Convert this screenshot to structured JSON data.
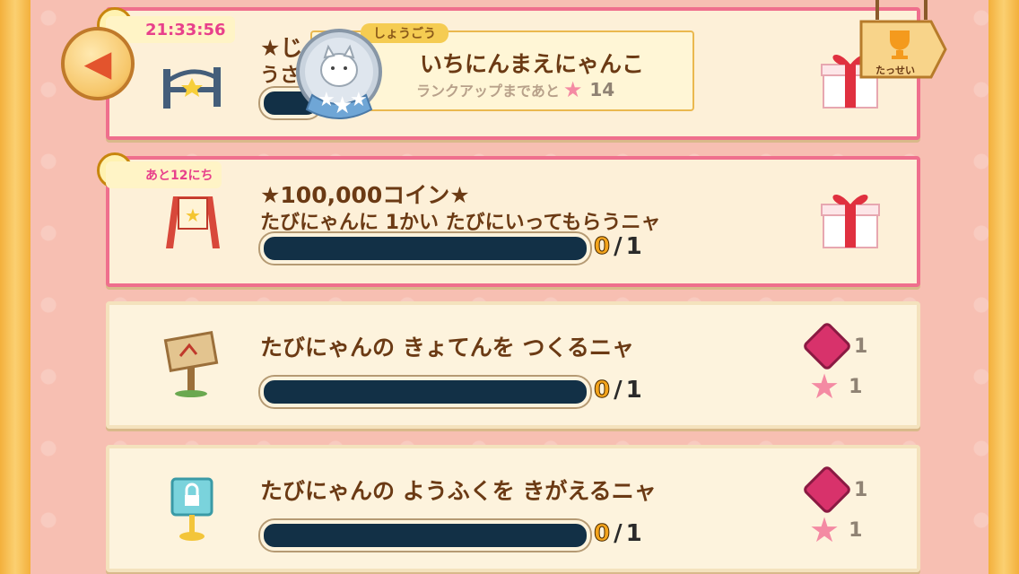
{
  "top_card": {
    "timer": "21:33:56",
    "title_partial": "★じ",
    "subtitle_partial": "うさ"
  },
  "rank_popup": {
    "tag": "しょうごう",
    "title": "いちにんまえにゃんこ",
    "sub_label": "ランクアップまであと",
    "stars_remaining": "14"
  },
  "achievement_sign": {
    "label": "たっせい"
  },
  "missions": [
    {
      "badge": "あと12にち",
      "title": "★100,000コイン★",
      "subtitle": "たびにゃんに 1かい たびにいってもらうニャ",
      "progress_current": "0",
      "progress_sep": "/",
      "progress_total": "1"
    },
    {
      "title": "たびにゃんの きょてんを つくるニャ",
      "progress_current": "0",
      "progress_sep": "/",
      "progress_total": "1",
      "reward_gem": "1",
      "reward_star": "1"
    },
    {
      "title": "たびにゃんの ようふくを きがえるニャ",
      "progress_current": "0",
      "progress_sep": "/",
      "progress_total": "1",
      "reward_gem": "1",
      "reward_star": "1"
    }
  ],
  "colors": {
    "accent_pink": "#ef6f8d",
    "text_brown": "#6b3a14",
    "progress_bar": "#123046"
  }
}
